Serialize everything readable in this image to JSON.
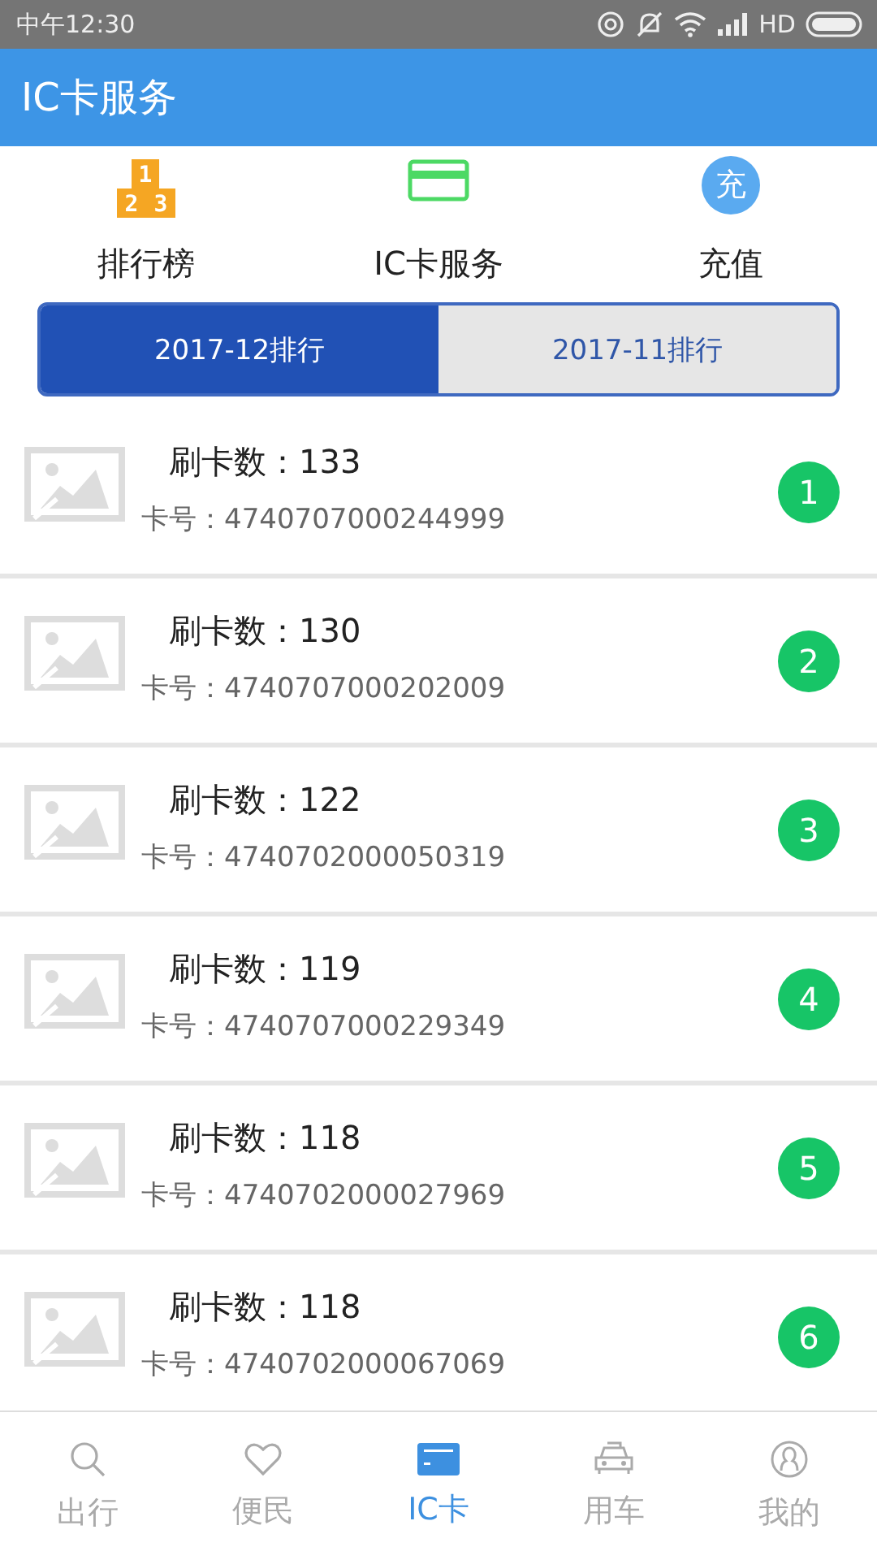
{
  "status_bar": {
    "time": "中午12:30",
    "network": "HD"
  },
  "app_bar": {
    "title": "IC卡服务"
  },
  "shortcuts": [
    {
      "kind": "ranking",
      "label": "排行榜",
      "icon_text": [
        "1",
        "2",
        "3"
      ]
    },
    {
      "kind": "card",
      "label": "IC卡服务"
    },
    {
      "kind": "recharge",
      "label": "充值",
      "icon_text": [
        "充"
      ]
    }
  ],
  "period_tabs": [
    {
      "label": "2017-12排行",
      "selected": true
    },
    {
      "label": "2017-11排行",
      "selected": false
    }
  ],
  "ranking": [
    {
      "count_label": "刷卡数：133",
      "card_label": "卡号：4740707000244999",
      "rank": "1"
    },
    {
      "count_label": "刷卡数：130",
      "card_label": "卡号：4740707000202009",
      "rank": "2"
    },
    {
      "count_label": "刷卡数：122",
      "card_label": "卡号：4740702000050319",
      "rank": "3"
    },
    {
      "count_label": "刷卡数：119",
      "card_label": "卡号：4740707000229349",
      "rank": "4"
    },
    {
      "count_label": "刷卡数：118",
      "card_label": "卡号：4740702000027969",
      "rank": "5"
    },
    {
      "count_label": "刷卡数：118",
      "card_label": "卡号：4740702000067069",
      "rank": "6"
    }
  ],
  "bottom_nav": [
    {
      "kind": "search",
      "label": "出行",
      "selected": false
    },
    {
      "kind": "heart",
      "label": "便民",
      "selected": false
    },
    {
      "kind": "card",
      "label": "IC卡",
      "selected": true
    },
    {
      "kind": "car",
      "label": "用车",
      "selected": false
    },
    {
      "kind": "user",
      "label": "我的",
      "selected": false
    }
  ]
}
